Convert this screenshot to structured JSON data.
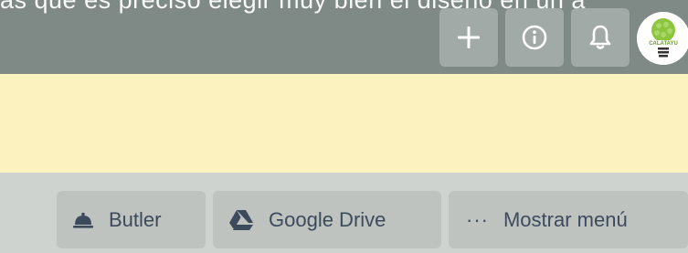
{
  "header": {
    "background_text": "as que es preciso elegir muy bien el diseño en un a",
    "buttons": [
      {
        "name": "add",
        "icon": "plus-icon"
      },
      {
        "name": "info",
        "icon": "info-icon"
      },
      {
        "name": "notifications",
        "icon": "bell-icon"
      }
    ],
    "avatar": {
      "logo_text": "CALATAYU"
    }
  },
  "board_bar": {
    "butler_label": "Butler",
    "drive_label": "Google Drive",
    "menu_icon": "···",
    "menu_label": "Mostrar menú"
  },
  "colors": {
    "header_bg": "#7f8a86",
    "banner_bg": "#fbf2c0",
    "bar_bg": "#cfd3d0",
    "button_bg": "#bfc3c0",
    "button_text": "#3d4a5c"
  }
}
